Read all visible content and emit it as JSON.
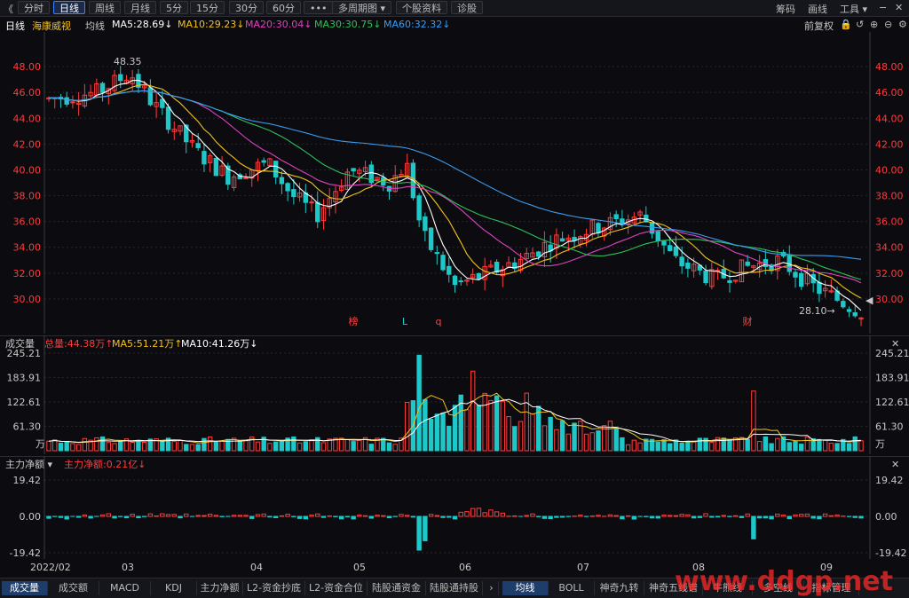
{
  "toolbar": {
    "back_glyph": "《",
    "periods": [
      "分时",
      "日线",
      "周线",
      "月线",
      "5分",
      "15分",
      "30分",
      "60分"
    ],
    "active_period": "日线",
    "more": "•••",
    "multi_period": "多周期图",
    "profile": "个股资料",
    "diagnose": "诊股",
    "right_items": [
      "筹码",
      "画线",
      "工具"
    ],
    "window_controls": [
      "−",
      "✕"
    ]
  },
  "infobar": {
    "period": "日线",
    "stock_name": "海康威视",
    "indicator": "均线",
    "ma": [
      {
        "label": "MA5:28.69",
        "color": "#ffffff"
      },
      {
        "label": "MA10:29.23",
        "color": "#f2c21c"
      },
      {
        "label": "MA20:30.04",
        "color": "#e040c0"
      },
      {
        "label": "MA30:30.75",
        "color": "#2ec05a"
      },
      {
        "label": "MA60:32.32",
        "color": "#3a9cf0"
      }
    ],
    "adjust": "前复权"
  },
  "main_axis": {
    "ticks": [
      "48.00",
      "46.00",
      "44.00",
      "42.00",
      "40.00",
      "38.00",
      "36.00",
      "34.00",
      "32.00",
      "30.00"
    ],
    "high_label": "48.35",
    "low_label": "28.10→",
    "markers": [
      {
        "text": "榜",
        "color": "#ff4040"
      },
      {
        "text": "L",
        "color": "#1ec8c8"
      },
      {
        "text": "q",
        "color": "#ff4040"
      },
      {
        "text": "财",
        "color": "#ff4040"
      }
    ]
  },
  "volume": {
    "title": "成交量",
    "total": "总量:44.38万",
    "ma5": "MA5:51.21万",
    "ma10": "MA10:41.26万",
    "ticks": [
      "245.21",
      "183.91",
      "122.61",
      "61.30"
    ],
    "unit": "万"
  },
  "flow": {
    "title": "主力净额",
    "value": "主力净额:0.21亿",
    "ticks": [
      "19.42",
      "0.00",
      "-19.42"
    ]
  },
  "x_axis": [
    "2022/02",
    "03",
    "04",
    "05",
    "06",
    "07",
    "08",
    "09"
  ],
  "bottom_tabs_left": [
    "成交量",
    "成交额",
    "MACD",
    "KDJ",
    "主力净额",
    "L2-资金抄底",
    "L2-资金合位",
    "陆股通资金",
    "陆股通持股"
  ],
  "active_bottom_left": "成交量",
  "bottom_tabs_right": [
    "均线",
    "BOLL",
    "神奇九转",
    "神奇五线谱",
    "牛熊线",
    "多空线",
    "指标管理"
  ],
  "active_bottom_right": "均线",
  "watermark": "www.ddgp.net",
  "colors": {
    "up": "#ff3b3b",
    "down": "#1ec8c8",
    "bg": "#0c0c10",
    "grid": "#26272e",
    "ma5": "#ffffff",
    "ma10": "#f2c21c",
    "ma20": "#e040c0",
    "ma30": "#2ec05a",
    "ma60": "#3a9cf0",
    "accent": "#3f7fff"
  }
}
